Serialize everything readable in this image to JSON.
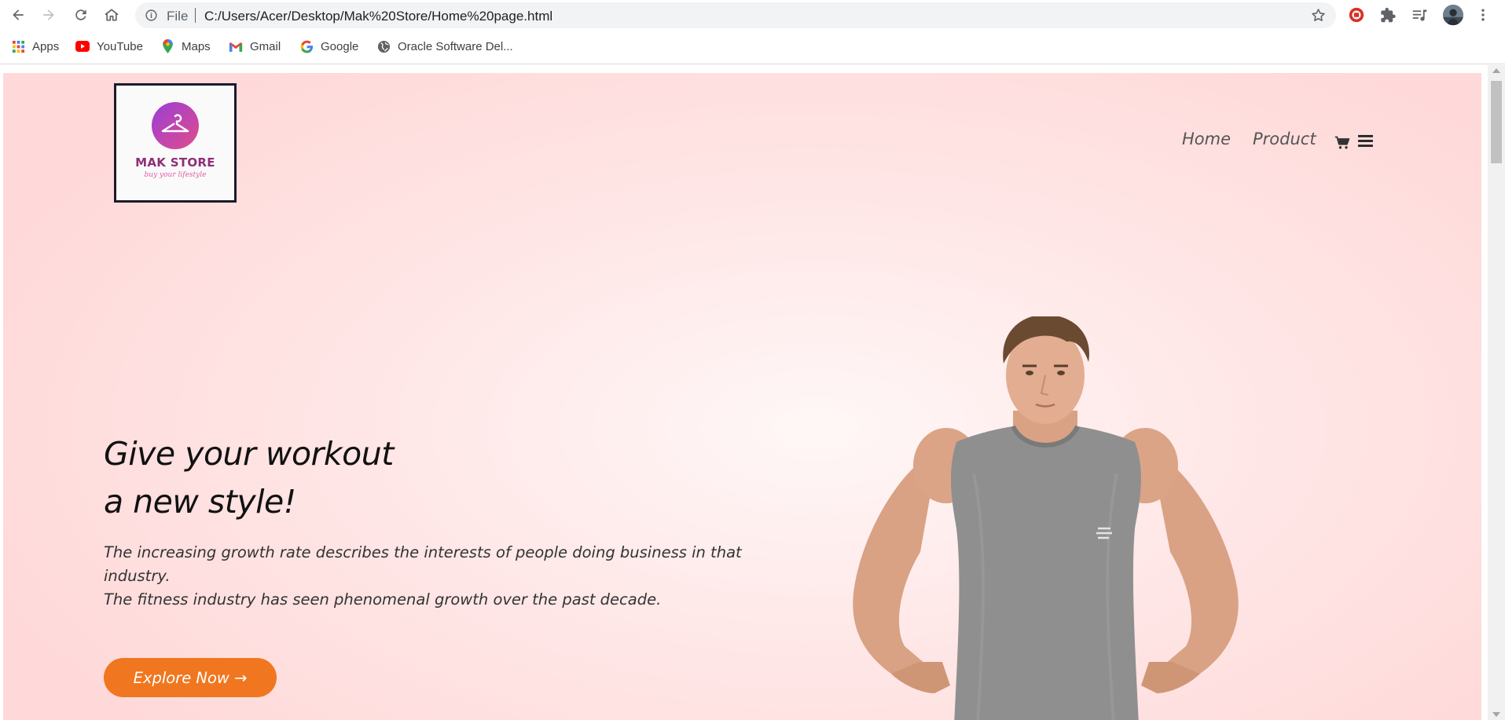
{
  "browser": {
    "url_scheme": "File",
    "url": "C:/Users/Acer/Desktop/Mak%20Store/Home%20page.html",
    "icons": {
      "back": "back-arrow-icon",
      "forward": "forward-arrow-icon",
      "reload": "reload-icon",
      "home": "home-icon",
      "info": "info-icon",
      "bookmark_star": "star-icon",
      "extension_red": "record-extension-icon",
      "extensions": "puzzle-icon",
      "media": "media-queue-icon",
      "profile": "avatar",
      "menu": "kebab-menu-icon"
    }
  },
  "bookmarks": [
    {
      "label": "Apps",
      "icon": "apps-grid-icon"
    },
    {
      "label": "YouTube",
      "icon": "youtube-icon"
    },
    {
      "label": "Maps",
      "icon": "maps-pin-icon"
    },
    {
      "label": "Gmail",
      "icon": "gmail-icon"
    },
    {
      "label": "Google",
      "icon": "google-icon"
    },
    {
      "label": "Oracle Software Del...",
      "icon": "globe-icon"
    }
  ],
  "site": {
    "logo": {
      "name": "MAK STORE",
      "tagline": "buy your lifestyle"
    },
    "nav": {
      "home": "Home",
      "product": "Product",
      "cart_icon": "cart-icon",
      "menu_icon": "hamburger-menu-icon"
    },
    "hero": {
      "title_line1": "Give your workout",
      "title_line2": "a new style!",
      "desc_line1": "The increasing growth rate describes the interests of people doing business in that industry.",
      "desc_line2": "The fitness industry has seen phenomenal growth over the past decade.",
      "cta": "Explore Now →",
      "image": "man-in-grey-sleeveless-shirt"
    },
    "colors": {
      "accent": "#f0771f",
      "background": "#ffd9d9",
      "logo_gradient_start": "#9b3fd6",
      "logo_gradient_end": "#e04c8a"
    }
  }
}
